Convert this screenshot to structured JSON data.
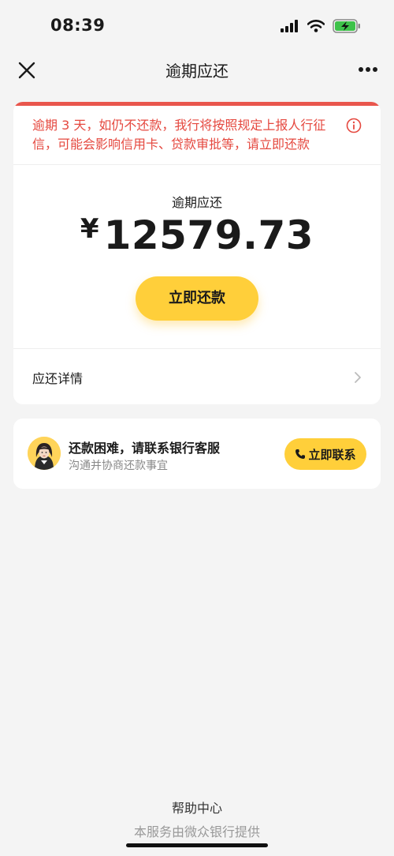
{
  "status_bar": {
    "time": "08:39"
  },
  "nav": {
    "title": "逾期应还",
    "close_icon": "close-icon",
    "more_icon": "more-icon"
  },
  "overdue_card": {
    "warning_text": "逾期 3 天，如仍不还款，我行将按照规定上报人行征信，可能会影响信用卡、贷款审批等，请立即还款",
    "amount_label": "逾期应还",
    "currency_symbol": "¥",
    "amount": "12579.73",
    "pay_button_label": "立即还款",
    "details_label": "应还详情",
    "accent_color": "#e9564d"
  },
  "support_card": {
    "title": "还款困难，请联系银行客服",
    "subtitle": "沟通并协商还款事宜",
    "contact_button_label": "立即联系"
  },
  "footer": {
    "help_link": "帮助中心",
    "provider_text": "本服务由微众银行提供"
  },
  "colors": {
    "brand_yellow": "#ffcf3a",
    "warning_red": "#e5483f"
  }
}
